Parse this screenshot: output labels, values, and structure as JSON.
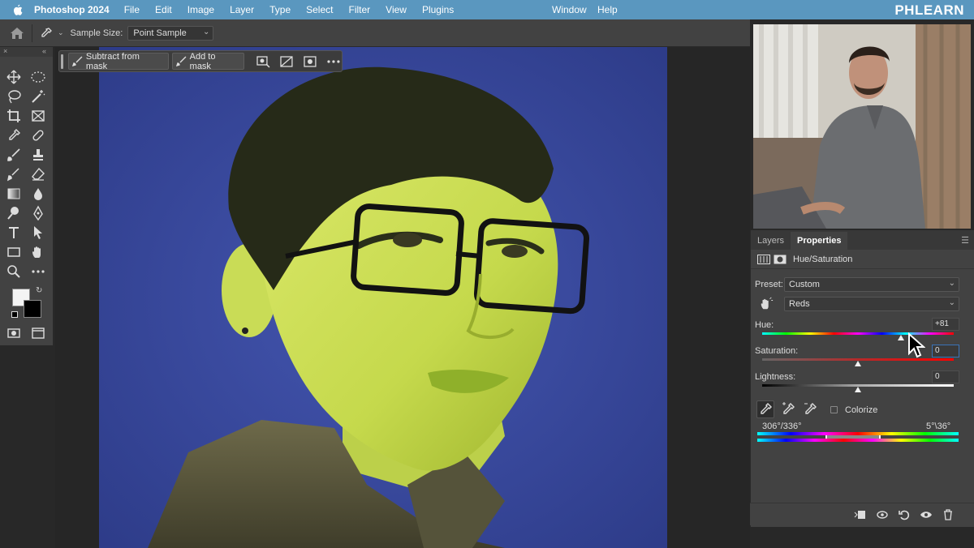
{
  "menubar": {
    "app_name": "Photoshop 2024",
    "items": [
      "File",
      "Edit",
      "Image",
      "Layer",
      "Type",
      "Select",
      "Filter",
      "View",
      "Plugins"
    ],
    "window": "Window",
    "help": "Help",
    "brand": "PHLEARN"
  },
  "options_bar": {
    "sample_size_label": "Sample Size:",
    "sample_size_value": "Point Sample"
  },
  "task_bar": {
    "subtract_label": "Subtract from mask",
    "add_label": "Add to mask"
  },
  "panel": {
    "tabs": [
      "Layers",
      "Properties"
    ],
    "active_tab": "Properties",
    "adjustment_title": "Hue/Saturation",
    "preset_label": "Preset:",
    "preset_value": "Custom",
    "channel_value": "Reds",
    "hue_label": "Hue:",
    "hue_value": "+81",
    "hue_level": 81,
    "saturation_label": "Saturation:",
    "saturation_value": "0",
    "saturation_level": 0,
    "lightness_label": "Lightness:",
    "lightness_value": "0",
    "lightness_level": 0,
    "colorize_label": "Colorize",
    "range_left": "306°/336°",
    "range_right": "5°\\36°"
  },
  "colors": {
    "menubar": "#5a97bf",
    "backdrop": "#3a4a9a",
    "skin": "#c7dc4c"
  }
}
